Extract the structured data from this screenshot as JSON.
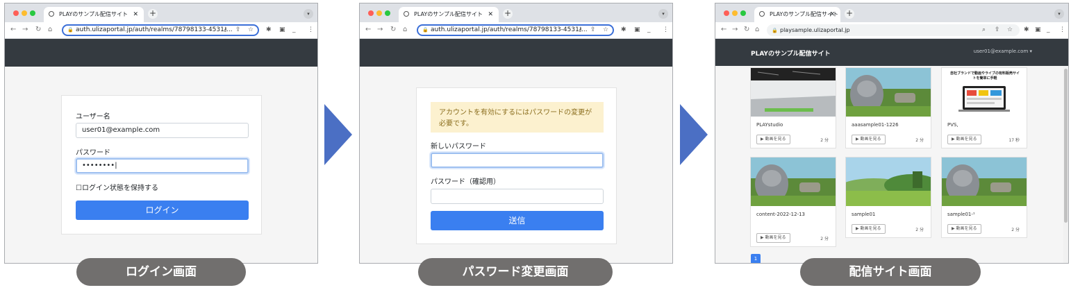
{
  "tab_title": "PLAYのサンプル配信サイト",
  "screens": [
    {
      "url": "auth.ulizaportal.jp/auth/realms/78798133-4531-...",
      "username_label": "ユーザー名",
      "username_value": "user01@example.com",
      "password_label": "パスワード",
      "password_value": "••••••••",
      "remember_label": "ログイン状態を保持する",
      "login_button": "ログイン",
      "caption": "ログイン画面"
    },
    {
      "url": "auth.ulizaportal.jp/auth/realms/78798133-4531-...",
      "alert_text": "アカウントを有効にするにはパスワードの変更が必要です。",
      "new_password_label": "新しいパスワード",
      "confirm_password_label": "パスワード（確認用）",
      "submit_button": "送信",
      "caption": "パスワード変更画面"
    },
    {
      "url": "playsample.ulizaportal.jp",
      "site_title": "PLAYのサンプル配信サイト",
      "user_menu": "user01@example.com ▾",
      "videos": [
        {
          "title": "PLAYstudio",
          "button": "▶ 動画を見る",
          "duration": "2 分",
          "thumb": "studio"
        },
        {
          "title": "aaasample01-1226",
          "button": "▶ 動画を見る",
          "duration": "2 分",
          "thumb": "bunny"
        },
        {
          "title": "PVS,",
          "button": "▶ 動画を見る",
          "duration": "17 秒",
          "thumb": "pvs"
        },
        {
          "title": "content-2022-12-13",
          "button": "▶ 動画を見る",
          "duration": "2 分",
          "thumb": "bunny"
        },
        {
          "title": "sample01",
          "button": "▶ 動画を見る",
          "duration": "2 分",
          "thumb": "meadow"
        },
        {
          "title": "sample01-¹",
          "button": "▶ 動画を見る",
          "duration": "2 分",
          "thumb": "bunny"
        }
      ],
      "pvs_headline": "自社ブランドで動画やライブの有料販売サイトを簡単に手軽",
      "page_number": "1",
      "caption": "配信サイト画面"
    }
  ],
  "colors": {
    "primary": "#3a7ff0",
    "header_dark": "#343a40",
    "arrow": "#4b6fc4",
    "caption_bg": "#716f6e",
    "alert_bg": "#fcf1cf"
  }
}
